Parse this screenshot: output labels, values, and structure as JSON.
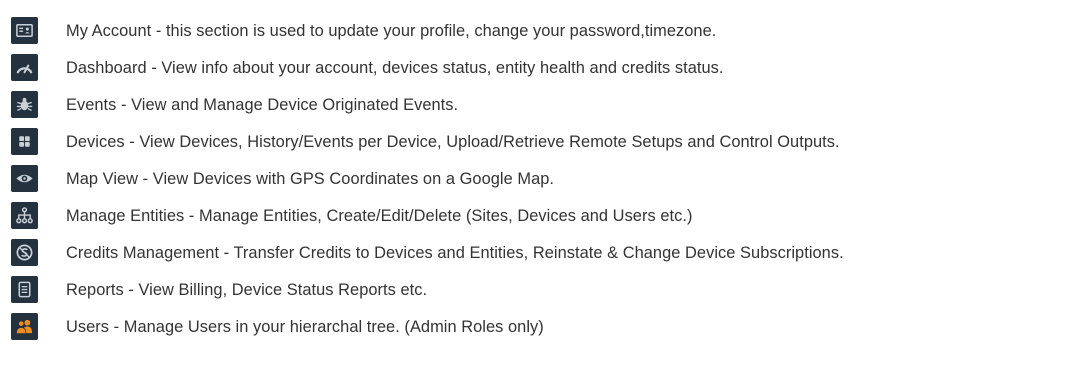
{
  "colors": {
    "icon_bg": "#24313f",
    "icon_fg": "#c9cfd6",
    "users_icon": "#f08c1e",
    "text": "#333333"
  },
  "items": [
    {
      "icon": "account-card-icon",
      "text": "My Account - this section is used to update your profile, change your password,timezone."
    },
    {
      "icon": "speedometer-icon",
      "text": "Dashboard - View info about your account, devices status, entity health and credits status."
    },
    {
      "icon": "bug-icon",
      "text": "Events - View and Manage Device Originated Events."
    },
    {
      "icon": "grid-icon",
      "text": "Devices - View Devices, History/Events per Device, Upload/Retrieve Remote Setups and Control Outputs."
    },
    {
      "icon": "eye-icon",
      "text": "Map View - View Devices with GPS Coordinates on a Google Map."
    },
    {
      "icon": "hierarchy-icon",
      "text": "Manage Entities - Manage Entities, Create/Edit/Delete (Sites, Devices and Users etc.)"
    },
    {
      "icon": "credits-icon",
      "text": "Credits Management - Transfer Credits to Devices and Entities, Reinstate & Change Device Subscriptions."
    },
    {
      "icon": "report-icon",
      "text": "Reports - View Billing, Device Status Reports etc."
    },
    {
      "icon": "users-icon",
      "text": "Users - Manage Users in your hierarchal tree. (Admin Roles only)"
    }
  ]
}
